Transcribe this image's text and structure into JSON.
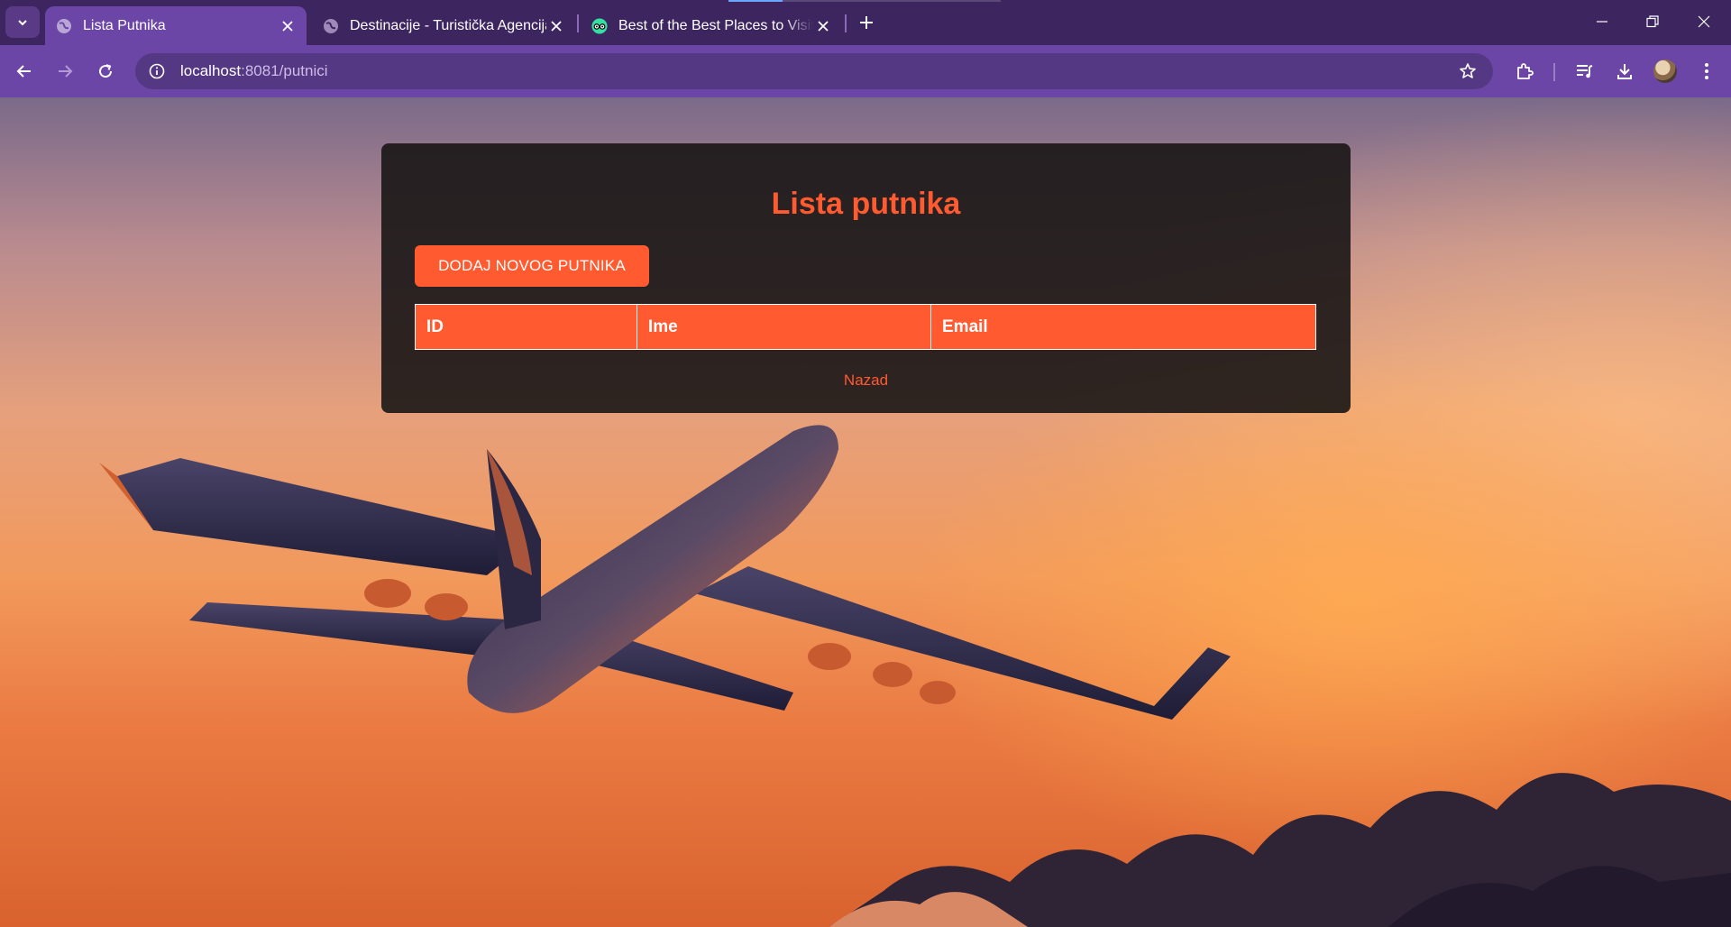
{
  "browser": {
    "tabs": [
      {
        "label": "Lista Putnika",
        "active": true,
        "favicon": "globe-icon"
      },
      {
        "label": "Destinacije - Turistička Agencija",
        "active": false,
        "favicon": "globe-icon"
      },
      {
        "label": "Best of the Best Places to Visit in",
        "active": false,
        "favicon": "tripadvisor-icon"
      }
    ],
    "url_host": "localhost",
    "url_rest": ":8081/putnici"
  },
  "page": {
    "title": "Lista putnika",
    "add_button_label": "DODAJ NOVOG PUTNIKA",
    "table": {
      "headers": [
        "ID",
        "Ime",
        "Email"
      ],
      "rows": []
    },
    "back_link": "Nazad"
  },
  "colors": {
    "accent": "#ff5a30",
    "chrome": "#6c46a6",
    "tabbar": "#3d2660"
  }
}
